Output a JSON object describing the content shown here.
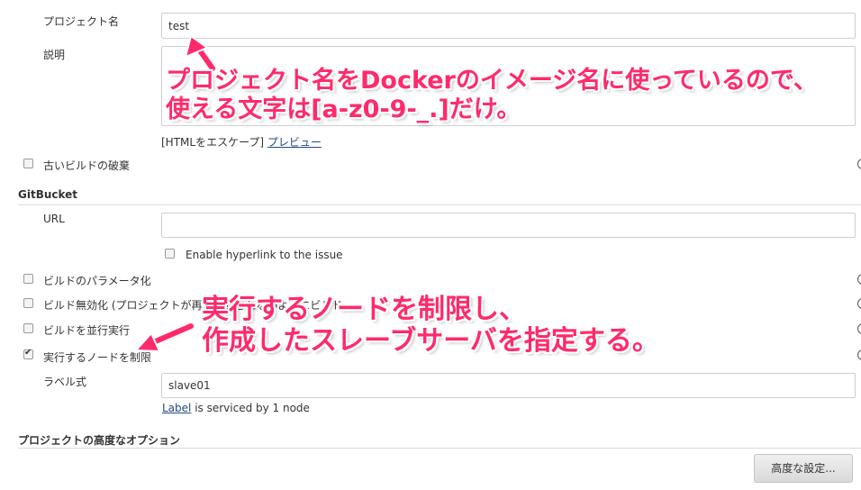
{
  "form": {
    "project_name_label": "プロジェクト名",
    "project_name_value": "test",
    "description_label": "説明",
    "description_value": "",
    "html_escape_text": "[HTMLをエスケープ]",
    "preview_link": "プレビュー",
    "discard_old_builds_label": "古いビルドの破棄"
  },
  "gitbucket": {
    "section_title": "GitBucket",
    "url_label": "URL",
    "url_value": "",
    "enable_hyperlink_label": "Enable hyperlink to the issue"
  },
  "options": {
    "parameterized_label": "ビルドのパラメータ化",
    "disable_build_label": "ビルド無効化 (プロジェクトが再ビルドされないようにビルド",
    "concurrent_build_label": "ビルドを並行実行",
    "restrict_node_label": "実行するノードを制限",
    "restrict_node_checked": true,
    "label_expression_label": "ラベル式",
    "label_expression_value": "slave01",
    "label_link": "Label",
    "label_serviced_text": " is serviced by 1 node"
  },
  "advanced": {
    "section_title": "プロジェクトの高度なオプション",
    "advanced_button": "高度な設定..."
  },
  "annotations": {
    "note1_line1": "プロジェクト名をDockerのイメージ名に使っているので、",
    "note1_line2": "使える文字は[a-z0-9-_.]だけ。",
    "note2_line1": "実行するノードを制限し、",
    "note2_line2": "作成したスレーブサーバを指定する。",
    "color": "#ff2a6a"
  }
}
